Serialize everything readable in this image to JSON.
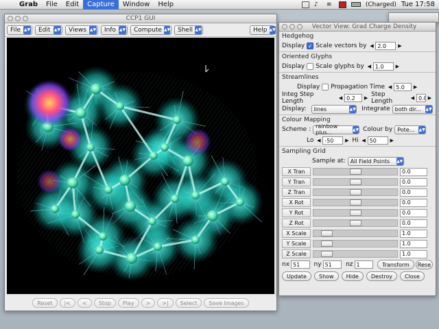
{
  "menubar": {
    "app": "Grab",
    "items": [
      "File",
      "Edit",
      "Capture",
      "Window",
      "Help"
    ],
    "active": "Capture",
    "battery": "(Charged)",
    "clock": "Tue 17:58"
  },
  "ccp1": {
    "title": "CCP1 GUI",
    "menus": [
      "File",
      "Edit",
      "Views",
      "Info",
      "Compute",
      "Shell"
    ],
    "help": "Help",
    "anim_buttons": [
      "Reset",
      "|<",
      "<",
      "Stop",
      "Play",
      ">",
      ">|",
      "Select",
      "Save Images"
    ]
  },
  "vv": {
    "title": "Vector View: Grad Charge Density",
    "hedgehog": {
      "head": "Hedgehog",
      "display_label": "Display",
      "display_checked": true,
      "scale_label": "Scale vectors by",
      "scale_value": "2.0"
    },
    "glyphs": {
      "head": "Oriented Glyphs",
      "display_label": "Display",
      "display_checked": false,
      "scale_label": "Scale glyphs by",
      "scale_value": "1.0"
    },
    "streamlines": {
      "head": "Streamlines",
      "display_label": "Display",
      "display_checked": false,
      "prop_label": "Propagation Time",
      "prop_value": "5.0",
      "integ_label": "Integ Step Length",
      "integ_value": "0.2",
      "step_label": "Step Length",
      "step_value": "0.0",
      "display2_label": "Display:",
      "display2_value": "lines",
      "integrate_label": "Integrate",
      "integrate_value": "both dir..."
    },
    "colour": {
      "head": "Colour Mapping",
      "scheme_label": "Scheme :",
      "scheme_value": "rainbow plus...",
      "colourby_label": "Colour by",
      "colourby_value": "Pote...",
      "lo_label": "Lo",
      "lo_value": "-50",
      "hi_label": "Hi",
      "hi_value": "50"
    },
    "grid": {
      "head": "Sampling Grid",
      "sample_label": "Sample at:",
      "sample_value": "All Field Points",
      "sliders": [
        {
          "label": "X Tran",
          "value": "0.0",
          "pos": 0.5
        },
        {
          "label": "Y Tran",
          "value": "0.0",
          "pos": 0.5
        },
        {
          "label": "Z Tran",
          "value": "0.0",
          "pos": 0.5
        },
        {
          "label": "X Rot",
          "value": "0.0",
          "pos": 0.5
        },
        {
          "label": "Y Rot",
          "value": "0.0",
          "pos": 0.5
        },
        {
          "label": "Z Rot",
          "value": "0.0",
          "pos": 0.5
        },
        {
          "label": "X Scale",
          "value": "1.0",
          "pos": 0.1
        },
        {
          "label": "Y Scale",
          "value": "1.0",
          "pos": 0.1
        },
        {
          "label": "Z Scale",
          "value": "1.0",
          "pos": 0.1
        }
      ],
      "nx_label": "nx",
      "nx": "51",
      "ny_label": "ny",
      "ny": "51",
      "nz_label": "nz",
      "nz": "1",
      "transform": "Transform",
      "reset": "Rese"
    },
    "buttons": [
      "Update",
      "Show",
      "Hide",
      "Destroy",
      "Close"
    ]
  },
  "colors": {
    "accent": "#3d6fd6",
    "molecule": "#33e8d8",
    "background": "#000000"
  }
}
